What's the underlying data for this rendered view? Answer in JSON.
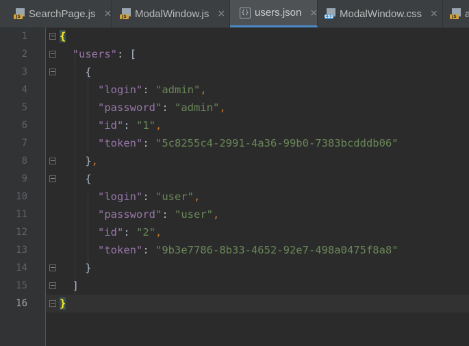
{
  "tabs": [
    {
      "label": "SearchPage.js",
      "icon": "js-file-icon",
      "active": false
    },
    {
      "label": "ModalWindow.js",
      "icon": "js-file-icon",
      "active": false
    },
    {
      "label": "users.json",
      "icon": "json-file-icon",
      "active": true
    },
    {
      "label": "ModalWindow.css",
      "icon": "css-file-icon",
      "active": false
    },
    {
      "label": "a",
      "icon": "js-file-icon",
      "active": false
    }
  ],
  "icons": {
    "js_badge": "JS",
    "css_badge": "CSS",
    "json_glyph": "{}",
    "close_glyph": "×"
  },
  "line_numbers": [
    "1",
    "2",
    "3",
    "4",
    "5",
    "6",
    "7",
    "8",
    "9",
    "10",
    "11",
    "12",
    "13",
    "14",
    "15",
    "16"
  ],
  "current_line": 16,
  "json": {
    "users_key": "\"users\"",
    "entries": [
      {
        "login_key": "\"login\"",
        "login_val": "\"admin\"",
        "password_key": "\"password\"",
        "password_val": "\"admin\"",
        "id_key": "\"id\"",
        "id_val": "\"1\"",
        "token_key": "\"token\"",
        "token_val": "\"5c8255c4-2991-4a36-99b0-7383bcdddb06\""
      },
      {
        "login_key": "\"login\"",
        "login_val": "\"user\"",
        "password_key": "\"password\"",
        "password_val": "\"user\"",
        "id_key": "\"id\"",
        "id_val": "\"2\"",
        "token_key": "\"token\"",
        "token_val": "\"9b3e7786-8b33-4652-92e7-498a0475f8a8\""
      }
    ]
  },
  "colors": {
    "background": "#2b2b2b",
    "gutter": "#313335",
    "key": "#9876aa",
    "string": "#6a8759",
    "punctuation": "#cc7832",
    "matched_brace": "#ffef28"
  }
}
